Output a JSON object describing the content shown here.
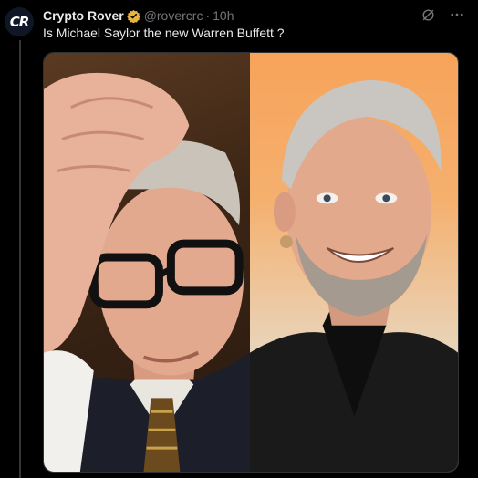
{
  "author": {
    "avatar_text": "CR",
    "display_name": "Crypto Rover",
    "handle": "@rovercrc",
    "separator": "·",
    "time": "10h",
    "verified_badge_color": "#e8b53c"
  },
  "tweet": {
    "text": "Is Michael Saylor the new Warren Buffett ?"
  },
  "actions": {
    "grok_icon": "grok-icon",
    "more_icon": "more-icon"
  },
  "media": {
    "left_photo": "man-with-glasses-hand-on-head-photo",
    "right_photo": "smiling-gray-haired-man-photo"
  },
  "colors": {
    "background": "#000000",
    "text_primary": "#e7e9ea",
    "text_secondary": "#71767b",
    "border": "#2f3336"
  }
}
